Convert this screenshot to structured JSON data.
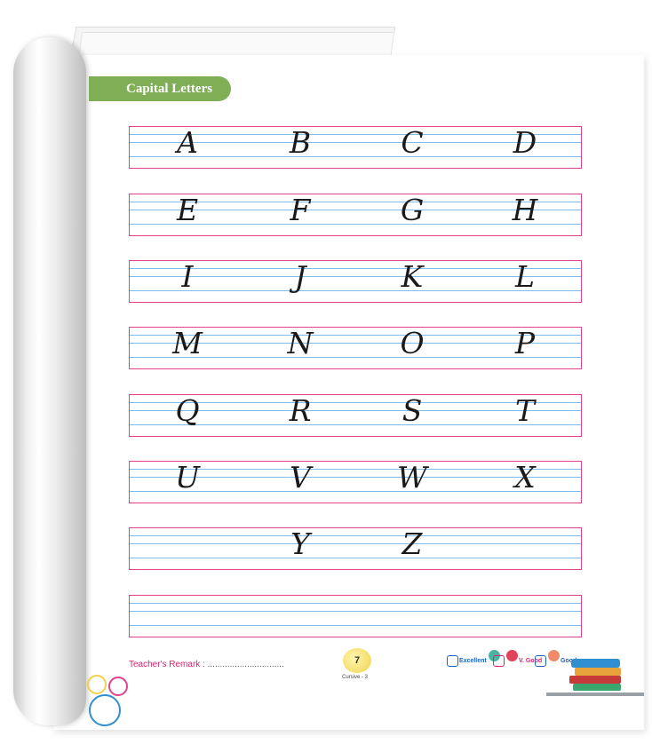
{
  "section_title": "Capital Letters",
  "rows": [
    [
      "A",
      "B",
      "C",
      "D"
    ],
    [
      "E",
      "F",
      "G",
      "H"
    ],
    [
      "I",
      "J",
      "K",
      "L"
    ],
    [
      "M",
      "N",
      "O",
      "P"
    ],
    [
      "Q",
      "R",
      "S",
      "T"
    ],
    [
      "U",
      "V",
      "W",
      "X"
    ],
    [
      "",
      "Y",
      "Z",
      ""
    ],
    [
      "",
      "",
      "",
      ""
    ]
  ],
  "footer": {
    "remark_label": "Teacher's Remark :",
    "remark_dots": "...............................",
    "page_number": "7",
    "book_label": "Cursive - 3",
    "ratings": [
      {
        "label": "Excellent",
        "color": "#1e63c4"
      },
      {
        "label": "V. Good",
        "color": "#d6246e"
      },
      {
        "label": "Good",
        "color": "#1e63c4"
      }
    ]
  },
  "colors": {
    "border": "#e4418a",
    "guide_line": "#7fbde8",
    "tab": "#7fae57"
  }
}
